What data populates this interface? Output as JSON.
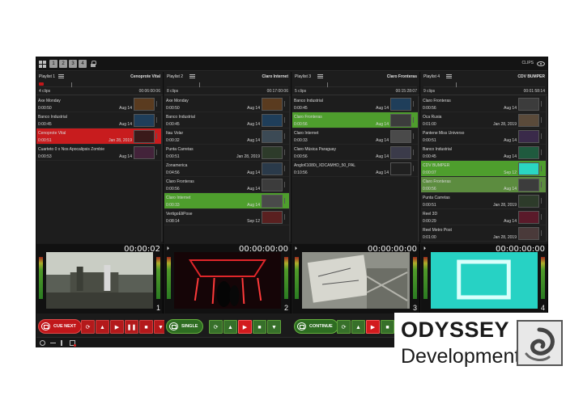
{
  "topbar": {
    "layout_buttons": [
      "1",
      "2",
      "3",
      "4"
    ],
    "clips_label": "CLIPS"
  },
  "playlists": [
    {
      "name": "Playlist 1",
      "now_playing": "Cenoprote Vital",
      "clip_count": "4 clips",
      "total": "00:06:00:06",
      "clips": [
        {
          "name": "Axe Monday",
          "duration": "0:00:50",
          "date": "Aug 14",
          "state": "normal",
          "thumb": "#5a3b1f"
        },
        {
          "name": "Banco Industrial",
          "duration": "0:00:45",
          "date": "Aug 14",
          "state": "normal",
          "thumb": "#1f3e5a"
        },
        {
          "name": "Cenoprote Vital",
          "duration": "0:00:51",
          "date": "Jan 28, 2019",
          "state": "red",
          "thumb": "#3a1a1a"
        },
        {
          "name": "Cuarteto 0 x Nos Apocalipsis Zombie",
          "duration": "0:00:53",
          "date": "Aug 14",
          "state": "normal",
          "thumb": "#43233a"
        }
      ]
    },
    {
      "name": "Playlist 2",
      "now_playing": "Claro Internet",
      "clip_count": "8 clips",
      "total": "00:17:00:06",
      "clips": [
        {
          "name": "Axe Monday",
          "duration": "0:00:50",
          "date": "Aug 14",
          "state": "normal",
          "thumb": "#5a3b1f"
        },
        {
          "name": "Banco Industrial",
          "duration": "0:00:45",
          "date": "Aug 14",
          "state": "normal",
          "thumb": "#1f3e5a"
        },
        {
          "name": "Itau Volar",
          "duration": "0:00:32",
          "date": "Aug 14",
          "state": "normal",
          "thumb": "#3c4a55"
        },
        {
          "name": "Punta Carretas",
          "duration": "0:00:51",
          "date": "Jan 28, 2019",
          "state": "normal",
          "thumb": "#2d3b2a"
        },
        {
          "name": "Zonamerica",
          "duration": "0:04:56",
          "date": "Aug 14",
          "state": "normal",
          "thumb": "#2a3a4a"
        },
        {
          "name": "Claro Fronteras",
          "duration": "0:00:56",
          "date": "Aug 14",
          "state": "normal",
          "thumb": "#3c3c3c"
        },
        {
          "name": "Claro Internet",
          "duration": "0:00:33",
          "date": "Aug 14",
          "state": "green",
          "thumb": "#4a4a4a"
        },
        {
          "name": "VertigoEliPose",
          "duration": "0:08:14",
          "date": "Sep 12",
          "state": "normal",
          "thumb": "#5a2020"
        }
      ]
    },
    {
      "name": "Playlist 3",
      "now_playing": "Claro Fronteras",
      "clip_count": "5 clips",
      "total": "00:15:28:07",
      "clips": [
        {
          "name": "Banco Industrial",
          "duration": "0:00:45",
          "date": "Aug 14",
          "state": "normal",
          "thumb": "#1f3e5a"
        },
        {
          "name": "Claro Fronteras",
          "duration": "0:00:56",
          "date": "Aug 14",
          "state": "green",
          "thumb": "#3c3c3c"
        },
        {
          "name": "Claro Internet",
          "duration": "0:00:33",
          "date": "Aug 14",
          "state": "normal",
          "thumb": "#4a4a4a"
        },
        {
          "name": "Claro Música Paraguay",
          "duration": "0:00:56",
          "date": "Aug 14",
          "state": "normal",
          "thumb": "#3b3b4a"
        },
        {
          "name": "Anglo€1080i_XDCAMHD_50_PAL",
          "duration": "0:10:56",
          "date": "Aug 14",
          "state": "normal",
          "thumb": "#202020"
        }
      ]
    },
    {
      "name": "Playlist 4",
      "now_playing": "CDV BUMPER",
      "clip_count": "9 clips",
      "total": "00:01:58:14",
      "clips": [
        {
          "name": "Claro Fronteras",
          "duration": "0:00:56",
          "date": "Aug 14",
          "state": "normal",
          "thumb": "#3c3c3c"
        },
        {
          "name": "Oca Rusia",
          "duration": "0:01:00",
          "date": "Jan 28, 2019",
          "state": "normal",
          "thumb": "#5a4a3a"
        },
        {
          "name": "Pantene Miss Universo",
          "duration": "0:00:51",
          "date": "Aug 14",
          "state": "normal",
          "thumb": "#3a2a4a"
        },
        {
          "name": "Banco Industrial",
          "duration": "0:00:45",
          "date": "Aug 14",
          "state": "normal",
          "thumb": "#1f5a3e"
        },
        {
          "name": "CDV BUMPER",
          "duration": "0:00:07",
          "date": "Sep 12",
          "state": "green",
          "thumb": "#2ad6c2"
        },
        {
          "name": "Claro Fronteras",
          "duration": "0:00:56",
          "date": "Aug 14",
          "state": "greendim",
          "thumb": "#3c3c3c"
        },
        {
          "name": "Punta Carretas",
          "duration": "0:00:51",
          "date": "Jan 28, 2019",
          "state": "normal",
          "thumb": "#2d3b2a"
        },
        {
          "name": "Reel 3D",
          "duration": "0:00:29",
          "date": "Aug 14",
          "state": "normal",
          "thumb": "#5a1a2a"
        },
        {
          "name": "Reel Metro Post",
          "duration": "0:01:00",
          "date": "Jan 28, 2019",
          "state": "normal",
          "thumb": "#4a3a3a"
        }
      ]
    }
  ],
  "players": [
    {
      "timecode": "00:00:02",
      "number": "1",
      "mode": "CUE NEXT"
    },
    {
      "timecode": "00:00:00:00",
      "number": "2",
      "mode": "SINGLE"
    },
    {
      "timecode": "00:00:00:00",
      "number": "3",
      "mode": "CONTINUE"
    },
    {
      "timecode": "00:00:00:00",
      "number": "4",
      "mode": ""
    }
  ],
  "controls": {
    "repeat_icon": "repeat-icon",
    "up_icon": "▲",
    "play_icon": "▶",
    "pause_icon": "❚❚",
    "stop_icon": "■",
    "down_icon": "▼"
  },
  "logo": {
    "title": "ODYSSEY",
    "subtitle": "Development"
  },
  "colors": {
    "accent_red": "#c81c1e",
    "accent_green": "#4e9e2d",
    "background": "#1b1b1b"
  }
}
